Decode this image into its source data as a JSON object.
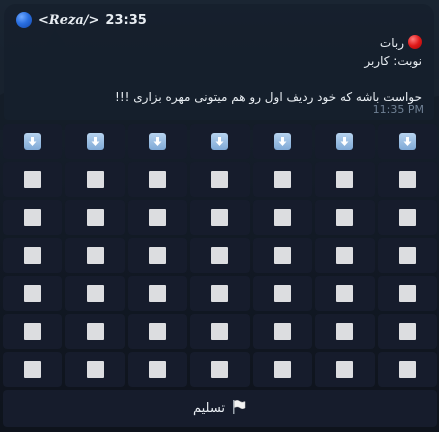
{
  "message": {
    "sender": "<Reza/>",
    "header_time": "23:35",
    "title": "ربات",
    "turn": "نوبت: کاربر",
    "hint": "حواست باشه که خود ردیف اول رو هم میتونی مهره بزاری !!!",
    "timestamp": "11:35 PM"
  },
  "board": {
    "columns": 7,
    "rows": 6,
    "drop_button_icon": "down-arrow-icon",
    "empty_cell_icon": "white-square-icon"
  },
  "surrender": {
    "label": "تسلیم",
    "icon": "white-flag-icon"
  },
  "colors": {
    "key_bg": "#161c2c",
    "arrow_bg": "#8fb6e0",
    "cell": "#dcdde0",
    "player_dot": "#2a6fe0",
    "bot_dot": "#e01818"
  }
}
